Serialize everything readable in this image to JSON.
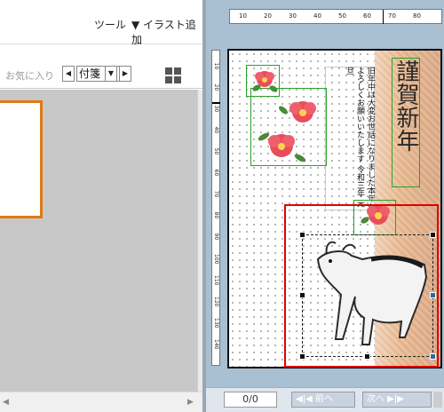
{
  "menu": {
    "tools_label": "ツール",
    "add_illustration_label": "▼ イラスト追加"
  },
  "toolbar": {
    "favorite_label": "お気に入り",
    "prev_symbol": "◀",
    "tag_value": "付箋",
    "dropdown_symbol": "▼",
    "next_symbol": "▶"
  },
  "ruler": {
    "h_ticks": [
      "10",
      "20",
      "30",
      "40",
      "50",
      "60",
      "70",
      "80"
    ],
    "v_ticks": [
      "10",
      "20",
      "30",
      "40",
      "50",
      "60",
      "70",
      "80",
      "90",
      "100",
      "110",
      "120",
      "130",
      "140"
    ]
  },
  "card": {
    "title": "謹賀新年",
    "message": "旧年中は大変お世話になりました本年もよろしくお願いいたします 令和三年 元旦",
    "colors": {
      "paper": "#e9b990",
      "selection": "#e00000",
      "frame": "#2aa02a"
    }
  },
  "footer": {
    "page_counter": "0/0",
    "prev_label": "◀|◀ 前へ",
    "next_label": "次へ ▶|▶"
  },
  "icons": [
    "grid-view-icon",
    "camellia-illustration",
    "ox-illustration"
  ]
}
